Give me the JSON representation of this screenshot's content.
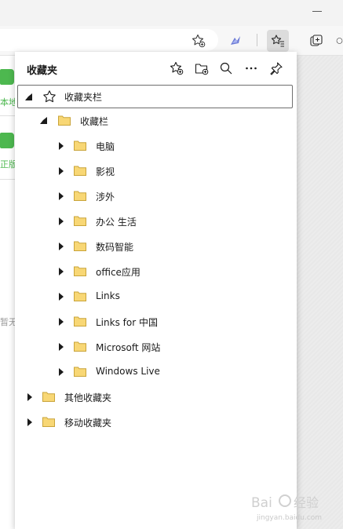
{
  "panel": {
    "title": "收藏夹"
  },
  "tree": [
    {
      "label": "收藏夹栏",
      "level": 0,
      "state": "expanded",
      "icon": "star-icon",
      "selected": true
    },
    {
      "label": "收藏栏",
      "level": 1,
      "state": "expanded",
      "icon": "folder-icon"
    },
    {
      "label": "电脑",
      "level": 2,
      "state": "collapsed",
      "icon": "folder-icon"
    },
    {
      "label": "影视",
      "level": 2,
      "state": "collapsed",
      "icon": "folder-icon"
    },
    {
      "label": "涉外",
      "level": 2,
      "state": "collapsed",
      "icon": "folder-icon"
    },
    {
      "label": "办公 生活",
      "level": 2,
      "state": "collapsed",
      "icon": "folder-icon"
    },
    {
      "label": "数码智能",
      "level": 2,
      "state": "collapsed",
      "icon": "folder-icon"
    },
    {
      "label": "office应用",
      "level": 2,
      "state": "collapsed",
      "icon": "folder-icon"
    },
    {
      "label": "Links",
      "level": 2,
      "state": "collapsed",
      "icon": "folder-icon"
    },
    {
      "label": "Links for 中国",
      "level": 2,
      "state": "collapsed",
      "icon": "folder-icon"
    },
    {
      "label": "Microsoft 网站",
      "level": 2,
      "state": "collapsed",
      "icon": "folder-icon"
    },
    {
      "label": "Windows Live",
      "level": 2,
      "state": "collapsed",
      "icon": "folder-icon"
    },
    {
      "label": "其他收藏夹",
      "level": 0,
      "state": "collapsed",
      "icon": "folder-icon"
    },
    {
      "label": "移动收藏夹",
      "level": 0,
      "state": "collapsed",
      "icon": "folder-icon"
    }
  ],
  "page": {
    "card1_text": "本地",
    "card2_text": "正版",
    "gray_text": "暂无"
  },
  "watermark": {
    "logo": "Bai 经验",
    "url": "jingyan.baidu.com"
  },
  "colors": {
    "folder_fill": "#f8d775",
    "folder_stroke": "#c9a43a",
    "accent_green": "#4db84f"
  }
}
